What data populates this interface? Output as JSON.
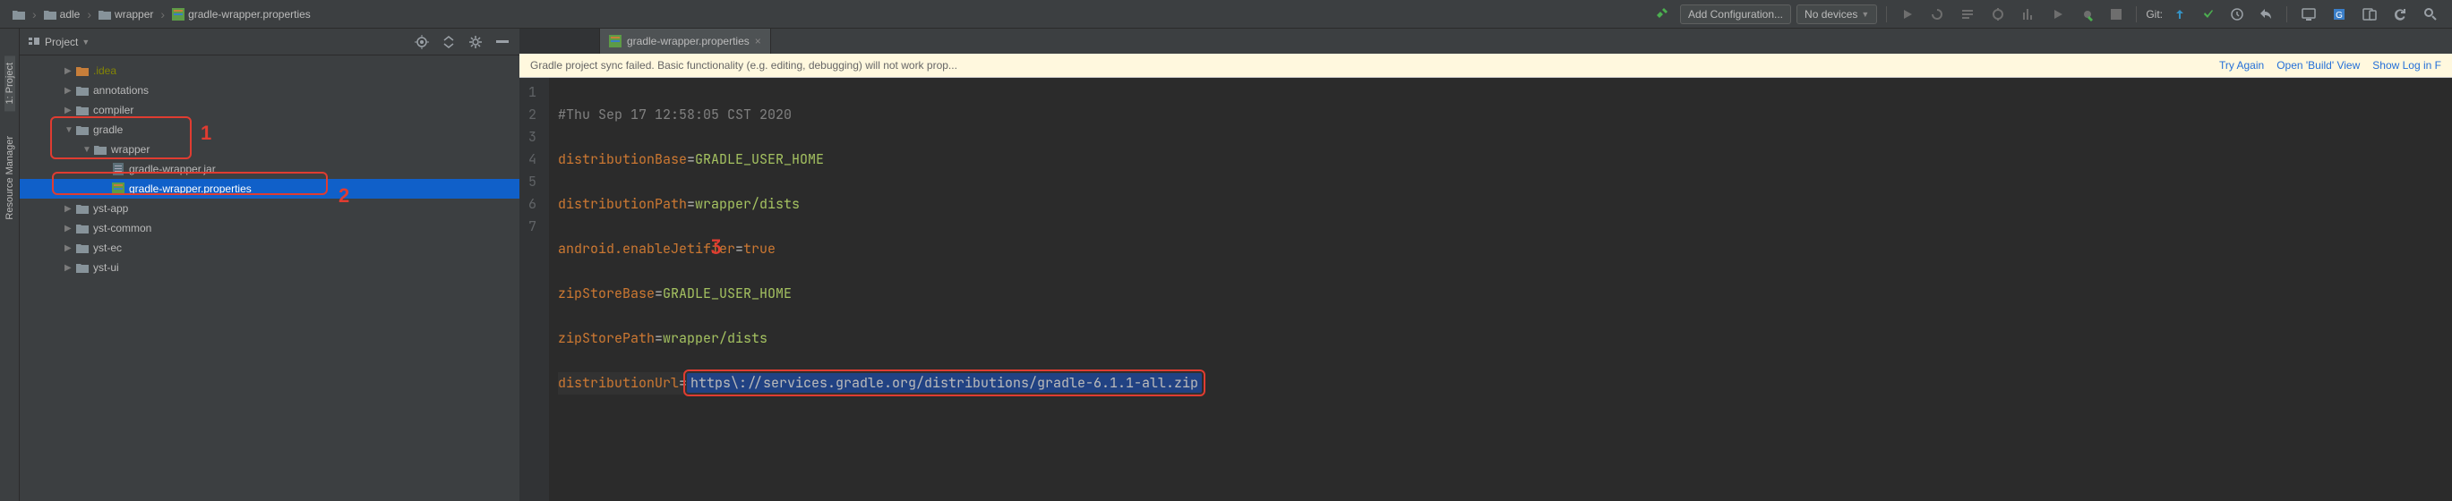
{
  "breadcrumb": {
    "seg1": "adle",
    "seg2": "wrapper",
    "seg3": "gradle-wrapper.properties"
  },
  "toolbar": {
    "addConfig": "Add Configuration...",
    "noDevices": "No devices",
    "gitLabel": "Git:"
  },
  "panel": {
    "title": "Project"
  },
  "sidebar": {
    "project": "1: Project",
    "resmgr": "Resource Manager"
  },
  "tree": {
    "idea": ".idea",
    "annotations": "annotations",
    "compiler": "compiler",
    "gradle": "gradle",
    "wrapper": "wrapper",
    "jar": "gradle-wrapper.jar",
    "props": "gradle-wrapper.properties",
    "ystapp": "yst-app",
    "ystcommon": "yst-common",
    "ystec": "yst-ec",
    "ystui": "yst-ui"
  },
  "anno": {
    "one": "1",
    "two": "2",
    "three": "3"
  },
  "tabs": {
    "active": "gradle-wrapper.properties"
  },
  "banner": {
    "msg": "Gradle project sync failed. Basic functionality (e.g. editing, debugging) will not work prop...",
    "tryAgain": "Try Again",
    "openBuild": "Open 'Build' View",
    "showLog": "Show Log in F"
  },
  "lines": {
    "n1": "1",
    "n2": "2",
    "n3": "3",
    "n4": "4",
    "n5": "5",
    "n6": "6",
    "n7": "7"
  },
  "code": {
    "l1": "#Thu Sep 17 12:58:05 CST 2020",
    "l2k": "distributionBase",
    "l2v": "GRADLE_USER_HOME",
    "l3k": "distributionPath",
    "l3v": "wrapper/dists",
    "l4k": "android.enableJetifier",
    "l4v": "true",
    "l5k": "zipStoreBase",
    "l5v": "GRADLE_USER_HOME",
    "l6k": "zipStorePath",
    "l6v": "wrapper/dists",
    "l7k": "distributionUrl",
    "l7v": "https\\://services.gradle.org/distributions/gradle-6.1.1-all.zip",
    "eq": "="
  }
}
